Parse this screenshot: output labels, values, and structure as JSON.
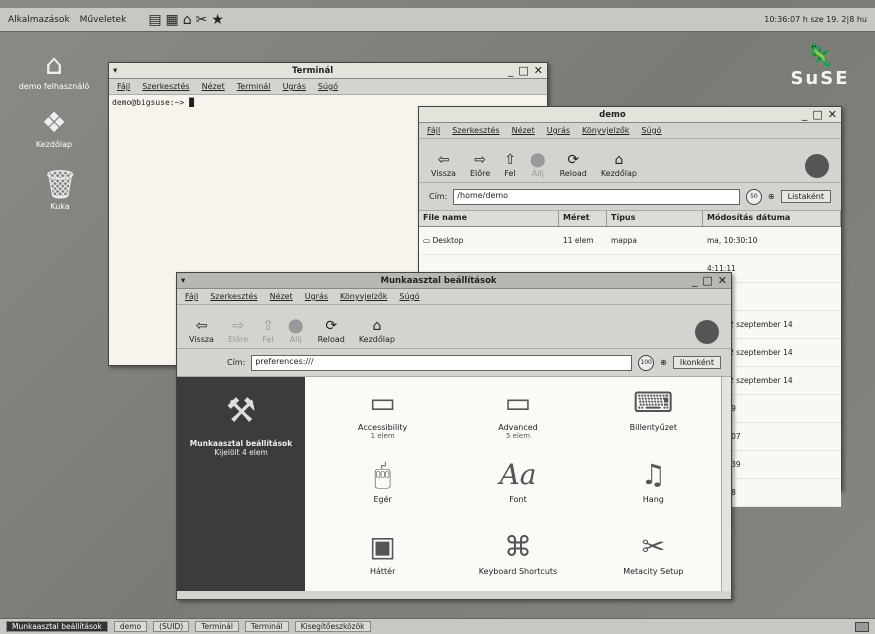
{
  "top_panel": {
    "menu": [
      "Alkalmazások",
      "Műveletek"
    ],
    "clock": "10:36:07 h sze 19. 2|8 hu"
  },
  "desktop_icons": [
    {
      "name": "home-icon",
      "label": "demo felhasználó"
    },
    {
      "name": "start-here-icon",
      "label": "Kezdőlap"
    },
    {
      "name": "trash-icon",
      "label": "Kuka"
    }
  ],
  "brand": {
    "logo_text": "SuSE"
  },
  "terminal": {
    "title": "Terminál",
    "menu": [
      "Fájl",
      "Szerkesztés",
      "Nézet",
      "Terminál",
      "Ugrás",
      "Súgó"
    ],
    "prompt": "demo@bigsuse:~> █"
  },
  "demo_window": {
    "title": "demo",
    "menu": [
      "Fájl",
      "Szerkesztés",
      "Nézet",
      "Ugrás",
      "Könyvjelzők",
      "Súgó"
    ],
    "toolbar": [
      "Vissza",
      "Előre",
      "Fel",
      "Állj",
      "Reload",
      "Kezdőlap"
    ],
    "location_label": "Cím:",
    "location_value": "/home/demo",
    "zoom": "50",
    "view": "Listaként",
    "columns": [
      "File name",
      "Méret",
      "Típus",
      "Módosítás dátuma"
    ],
    "rows": [
      {
        "name": "Desktop",
        "size": "11 elem",
        "type": "mappa",
        "date": "ma, 10:30:10"
      },
      {
        "name": "",
        "size": "",
        "type": "",
        "date": "4:11:11"
      },
      {
        "name": "",
        "size": "",
        "type": "",
        "date": "28:15"
      },
      {
        "name": "",
        "size": "",
        "type": "",
        "date": "t, 2002 szeptember 14"
      },
      {
        "name": "",
        "size": "",
        "type": "",
        "date": "t, 2002 szeptember 14"
      },
      {
        "name": "",
        "size": "",
        "type": "",
        "date": "t, 2002 szeptember 14"
      },
      {
        "name": "",
        "size": "",
        "type": "",
        "date": "0:48:49"
      },
      {
        "name": "",
        "size": "",
        "type": "",
        "date": "10:12:07"
      },
      {
        "name": "",
        "size": "",
        "type": "",
        "date": "10:11:39"
      },
      {
        "name": "",
        "size": "",
        "type": "",
        "date": "2:35:28"
      }
    ]
  },
  "prefs_window": {
    "title": "Munkaasztal beállítások",
    "menu": [
      "Fájl",
      "Szerkesztés",
      "Nézet",
      "Ugrás",
      "Könyvjelzők",
      "Súgó"
    ],
    "toolbar": [
      "Vissza",
      "Előre",
      "Fel",
      "Állj",
      "Reload",
      "Kezdőlap"
    ],
    "location_label": "Cím:",
    "location_value": "preferences:///",
    "zoom": "100",
    "view": "Ikonként",
    "side_title": "Munkaasztal beállítások",
    "side_sub": "Kijelölt 4 elem",
    "items": [
      {
        "icon": "folder-icon",
        "label": "Accessibility",
        "sub": "1 elem"
      },
      {
        "icon": "folder-icon",
        "label": "Advanced",
        "sub": "5 elem"
      },
      {
        "icon": "keyboard-icon",
        "label": "Billentyűzet",
        "sub": ""
      },
      {
        "icon": "mouse-icon",
        "label": "Egér",
        "sub": ""
      },
      {
        "icon": "font-icon",
        "label": "Font",
        "sub": ""
      },
      {
        "icon": "sound-icon",
        "label": "Hang",
        "sub": ""
      },
      {
        "icon": "background-icon",
        "label": "Háttér",
        "sub": ""
      },
      {
        "icon": "keyboard-shortcuts-icon",
        "label": "Keyboard Shortcuts",
        "sub": ""
      },
      {
        "icon": "metacity-icon",
        "label": "Metacity Setup",
        "sub": ""
      }
    ]
  },
  "taskbar": [
    "Munkaasztal beállítások",
    "demo",
    "(SUID)",
    "Terminál",
    "Terminál",
    "Kisegítőeszközök"
  ]
}
